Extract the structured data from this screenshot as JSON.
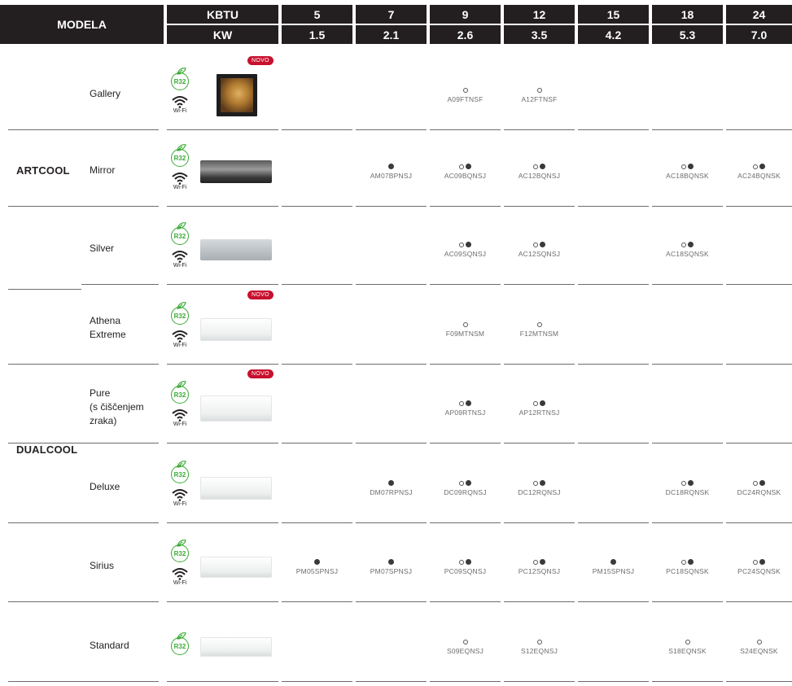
{
  "header": {
    "modela": "MODELA",
    "kbtu_label": "KBTU",
    "kw_label": "KW",
    "columns": [
      {
        "kbtu": "5",
        "kw": "1.5"
      },
      {
        "kbtu": "7",
        "kw": "2.1"
      },
      {
        "kbtu": "9",
        "kw": "2.6"
      },
      {
        "kbtu": "12",
        "kw": "3.5"
      },
      {
        "kbtu": "15",
        "kw": "4.2"
      },
      {
        "kbtu": "18",
        "kw": "5.3"
      },
      {
        "kbtu": "24",
        "kw": "7.0"
      }
    ]
  },
  "groups": [
    {
      "name": "ARTCOOL"
    },
    {
      "name": "DUALCOOL"
    }
  ],
  "badges": {
    "r32": "R32",
    "wifi": "Wi-Fi",
    "novo": "NOVO"
  },
  "symbols": {
    "open": "○",
    "full": "●"
  },
  "colors": {
    "header_bg": "#231f20",
    "r32_green": "#3aaa35",
    "novo_red": "#c8102e"
  },
  "rows": [
    {
      "name_lines": [
        "Gallery"
      ],
      "novo": true,
      "wifi": true,
      "cells": [
        "",
        "",
        "A09FTNSF",
        "A12FTNSF",
        "",
        "",
        ""
      ],
      "marks": [
        "",
        "",
        "open",
        "open",
        "",
        "",
        ""
      ]
    },
    {
      "name_lines": [
        "Mirror"
      ],
      "novo": false,
      "wifi": true,
      "cells": [
        "",
        "AM07BPNSJ",
        "AC09BQNSJ",
        "AC12BQNSJ",
        "",
        "AC18BQNSK",
        "AC24BQNSK"
      ],
      "marks": [
        "",
        "full",
        "both",
        "both",
        "",
        "both",
        "both"
      ]
    },
    {
      "name_lines": [
        "Silver"
      ],
      "novo": false,
      "wifi": true,
      "cells": [
        "",
        "",
        "AC09SQNSJ",
        "AC12SQNSJ",
        "",
        "AC18SQNSK",
        ""
      ],
      "marks": [
        "",
        "",
        "both",
        "both",
        "",
        "both",
        ""
      ]
    },
    {
      "name_lines": [
        "Athena",
        "Extreme"
      ],
      "novo": true,
      "wifi": true,
      "cells": [
        "",
        "",
        "F09MTNSM",
        "F12MTNSM",
        "",
        "",
        ""
      ],
      "marks": [
        "",
        "",
        "open",
        "open",
        "",
        "",
        ""
      ]
    },
    {
      "name_lines": [
        "Pure",
        "(s čiščenjem",
        "zraka)"
      ],
      "novo": true,
      "wifi": true,
      "cells": [
        "",
        "",
        "AP09RTNSJ",
        "AP12RTNSJ",
        "",
        "",
        ""
      ],
      "marks": [
        "",
        "",
        "both",
        "both",
        "",
        "",
        ""
      ]
    },
    {
      "name_lines": [
        "Deluxe"
      ],
      "novo": false,
      "wifi": true,
      "cells": [
        "",
        "DM07RPNSJ",
        "DC09RQNSJ",
        "DC12RQNSJ",
        "",
        "DC18RQNSK",
        "DC24RQNSK"
      ],
      "marks": [
        "",
        "full",
        "both",
        "both",
        "",
        "both",
        "both"
      ]
    },
    {
      "name_lines": [
        "Sirius"
      ],
      "novo": false,
      "wifi": true,
      "cells": [
        "PM05SPNSJ",
        "PM07SPNSJ",
        "PC09SQNSJ",
        "PC12SQNSJ",
        "PM15SPNSJ",
        "PC18SQNSK",
        "PC24SQNSK"
      ],
      "marks": [
        "full",
        "full",
        "both",
        "both",
        "full",
        "both",
        "both"
      ]
    },
    {
      "name_lines": [
        "Standard"
      ],
      "novo": false,
      "wifi": false,
      "cells": [
        "",
        "",
        "S09EQNSJ",
        "S12EQNSJ",
        "",
        "S18EQNSK",
        "S24EQNSK"
      ],
      "marks": [
        "",
        "",
        "open",
        "open",
        "",
        "open",
        "open"
      ]
    }
  ]
}
